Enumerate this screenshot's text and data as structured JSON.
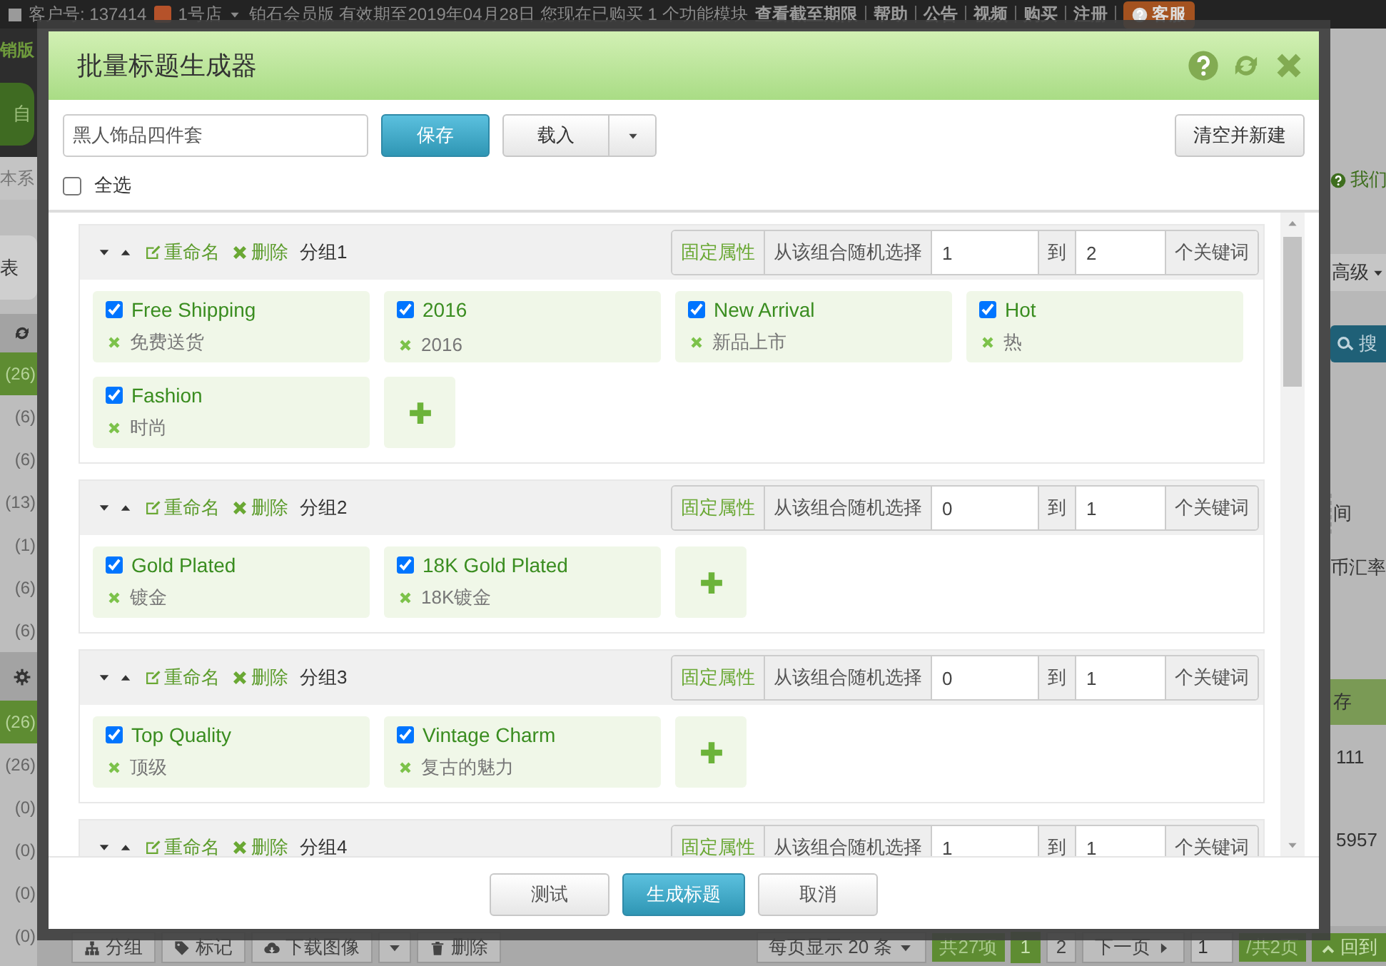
{
  "top_bar": {
    "customer": "客户号: 137414",
    "shop": "1号店",
    "membership": "铂石会员版 有效期至2019年04月28日 您现在已购买 1 个功能模块",
    "deadline_link": "查看截至期限",
    "links": [
      "帮助",
      "公告",
      "视频",
      "购买",
      "注册"
    ],
    "service_button": "客服"
  },
  "sidebar": {
    "items": [
      {
        "kind": "brand",
        "text": "销版"
      },
      {
        "kind": "logo",
        "text": "自"
      },
      {
        "kind": "note",
        "text": "本系"
      },
      {
        "kind": "tab",
        "text": "表"
      },
      {
        "kind": "refresh-header"
      },
      {
        "kind": "count",
        "text": "(26)",
        "selected": true
      },
      {
        "kind": "count",
        "text": "(6)",
        "selected": false
      },
      {
        "kind": "count",
        "text": "(6)",
        "selected": false
      },
      {
        "kind": "count",
        "text": "(13)",
        "selected": false
      },
      {
        "kind": "count",
        "text": "(1)",
        "selected": false
      },
      {
        "kind": "count",
        "text": "(6)",
        "selected": false
      },
      {
        "kind": "count",
        "text": "(6)",
        "selected": false
      },
      {
        "kind": "gear-header"
      },
      {
        "kind": "count",
        "text": "(26)",
        "selected": true
      },
      {
        "kind": "count",
        "text": "(26)",
        "selected": false
      },
      {
        "kind": "count",
        "text": "(0)",
        "selected": false
      },
      {
        "kind": "count",
        "text": "(0)",
        "selected": false
      },
      {
        "kind": "count",
        "text": "(0)",
        "selected": false
      },
      {
        "kind": "count",
        "text": "(0)",
        "selected": false
      }
    ]
  },
  "right_panel": {
    "items": [
      {
        "kind": "help-link",
        "text": "我们"
      },
      {
        "kind": "dropdown",
        "text": "高级"
      },
      {
        "kind": "search-button",
        "text": "搜"
      },
      {
        "kind": "field-text",
        "text": "间"
      },
      {
        "kind": "text",
        "text": "币汇率"
      },
      {
        "kind": "column-header",
        "text": "存"
      },
      {
        "kind": "cell",
        "text": "111"
      },
      {
        "kind": "cell",
        "text": "5957"
      }
    ]
  },
  "bottom_bar": {
    "actions": [
      {
        "kind": "group",
        "label": "分组"
      },
      {
        "kind": "tag",
        "label": "标记"
      },
      {
        "kind": "download",
        "label": "下载图像"
      },
      {
        "kind": "caret"
      },
      {
        "kind": "trash",
        "label": "删除"
      }
    ],
    "pager": {
      "page_size": "每页显示 20 条",
      "total": "共27项",
      "pages": [
        {
          "label": "1",
          "selected": true
        },
        {
          "label": "2",
          "selected": false
        }
      ],
      "next": "下一页",
      "page_input": "1",
      "page_count": "/共2页",
      "back_top": "回到"
    }
  },
  "dialog": {
    "title": "批量标题生成器",
    "name_field": {
      "value": "黑人饰品四件套"
    },
    "save": "保存",
    "load": "载入",
    "clear": "清空并新建",
    "select_all": {
      "label": "全选",
      "checked": false
    },
    "groups": [
      {
        "name": "分组1",
        "rename": "重命名",
        "delete": "删除",
        "fixed": "固定属性",
        "random": "从该组合随机选择",
        "min": "1",
        "to": "到",
        "max": "2",
        "unit": "个关键词",
        "keywords": [
          {
            "label": "Free Shipping",
            "translation": "免费送货",
            "checked": true
          },
          {
            "label": "2016",
            "translation": "2016",
            "checked": true
          },
          {
            "label": "New Arrival",
            "translation": "新品上市",
            "checked": true
          },
          {
            "label": "Hot",
            "translation": "热",
            "checked": true
          },
          {
            "label": "Fashion",
            "translation": "时尚",
            "checked": true
          }
        ]
      },
      {
        "name": "分组2",
        "rename": "重命名",
        "delete": "删除",
        "fixed": "固定属性",
        "random": "从该组合随机选择",
        "min": "0",
        "to": "到",
        "max": "1",
        "unit": "个关键词",
        "keywords": [
          {
            "label": "Gold Plated",
            "translation": "镀金",
            "checked": true
          },
          {
            "label": "18K Gold Plated",
            "translation": "18K镀金",
            "checked": true
          }
        ]
      },
      {
        "name": "分组3",
        "rename": "重命名",
        "delete": "删除",
        "fixed": "固定属性",
        "random": "从该组合随机选择",
        "min": "0",
        "to": "到",
        "max": "1",
        "unit": "个关键词",
        "keywords": [
          {
            "label": "Top Quality",
            "translation": "顶级",
            "checked": true
          },
          {
            "label": "Vintage Charm",
            "translation": "复古的魅力",
            "checked": true
          }
        ]
      },
      {
        "name": "分组4",
        "rename": "重命名",
        "delete": "删除",
        "fixed": "固定属性",
        "random": "从该组合随机选择",
        "min": "1",
        "to": "到",
        "max": "1",
        "unit": "个关键词"
      }
    ],
    "footer": [
      {
        "label": "测试",
        "kind": "default"
      },
      {
        "label": "生成标题",
        "kind": "primary"
      },
      {
        "label": "取消",
        "kind": "default"
      }
    ]
  }
}
